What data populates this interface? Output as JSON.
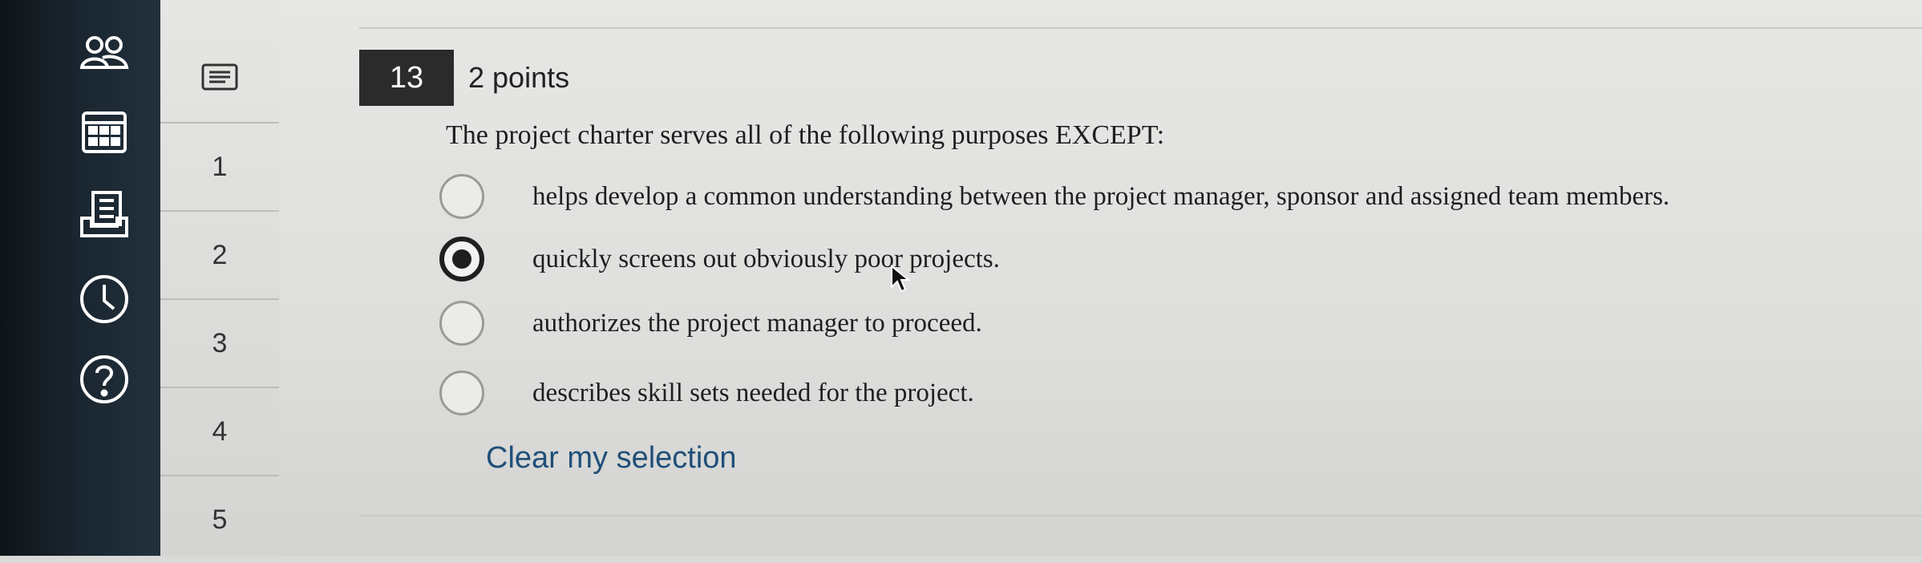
{
  "left_rail": {
    "icons": [
      "people-icon",
      "calendar-icon",
      "inbox-icon",
      "clock-icon",
      "help-icon"
    ]
  },
  "question_nav": {
    "top_icon": "notes-icon",
    "items": [
      "1",
      "2",
      "3",
      "4",
      "5"
    ]
  },
  "question": {
    "number": "13",
    "points": "2 points",
    "text": "The project charter serves all of the following purposes EXCEPT:",
    "options": [
      {
        "label": "helps develop a common understanding between the project manager, sponsor and assigned team members.",
        "selected": false
      },
      {
        "label": "quickly screens out obviously poor projects.",
        "selected": true
      },
      {
        "label": "authorizes the project manager to proceed.",
        "selected": false
      },
      {
        "label": "describes skill sets needed for the project.",
        "selected": false
      }
    ],
    "clear_label": "Clear my selection"
  },
  "colors": {
    "rail_bg": "#1a2630",
    "link": "#1f4f79",
    "selected_radio": "#1f1f1f"
  }
}
